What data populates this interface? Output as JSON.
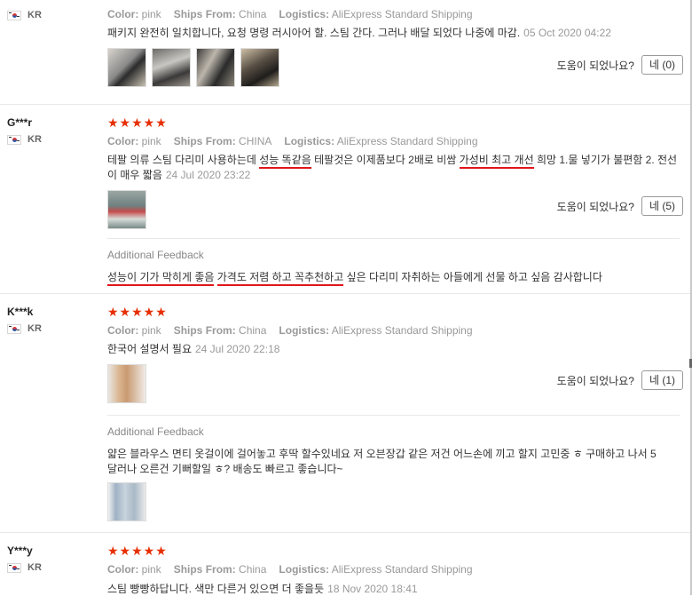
{
  "reviews": [
    {
      "name": "",
      "country": "KR",
      "stars": "",
      "color_label": "Color:",
      "color": "pink",
      "ships_label": "Ships From:",
      "ships": "China",
      "logistics_label": "Logistics:",
      "logistics": "AliExpress Standard Shipping",
      "text": "패키지 완전히 일치합니다, 요청 명령 러시아어 할. 스팀 간다. 그러나 배달 되었다 나중에 마감.",
      "date": "05 Oct 2020 04:22",
      "helpful_question": "도움이 되었나요?",
      "helpful_button": "네 (0)"
    },
    {
      "name": "G***r",
      "country": "KR",
      "stars": "★★★★★",
      "color_label": "Color:",
      "color": "pink",
      "ships_label": "Ships From:",
      "ships": "CHINA",
      "logistics_label": "Logistics:",
      "logistics": "AliExpress Standard Shipping",
      "text_parts": [
        "테팔 의류 스팀 다리미 사용하는데 ",
        "성능 똑같음",
        " 테팔것은 이제품보다 2배로 비쌈 ",
        "가성비 최고 개선",
        " 희망 1.물 넣기가 불편함 2. 전선이 매우 짧음"
      ],
      "date": "24 Jul 2020 23:22",
      "helpful_question": "도움이 되었나요?",
      "helpful_button": "네 (5)",
      "additional_label": "Additional Feedback",
      "additional_parts": [
        "성능이 기가 막히게 좋음",
        " ",
        "가격도 저렴 하고 꼭추천하고",
        " 싶은 다리미 자취하는 아들에게 선물 하고 싶음 감사합니다"
      ]
    },
    {
      "name": "K***k",
      "country": "KR",
      "stars": "★★★★★",
      "color_label": "Color:",
      "color": "pink",
      "ships_label": "Ships From:",
      "ships": "China",
      "logistics_label": "Logistics:",
      "logistics": "AliExpress Standard Shipping",
      "text": "한국어 설명서 필요",
      "date": "24 Jul 2020 22:18",
      "helpful_question": "도움이 되었나요?",
      "helpful_button": "네 (1)",
      "additional_label": "Additional Feedback",
      "additional_text": "얇은 블라우스 면티 옷걸이에 걸어놓고 후딱 할수있네요 저 오븐장갑 같은 저건 어느손에 끼고 할지 고민중 ㅎ 구매하고 나서 5달러나 오른건 기뻐할일 ㅎ? 배송도 빠르고 좋습니다~"
    },
    {
      "name": "Y***y",
      "country": "KR",
      "stars": "★★★★★",
      "color_label": "Color:",
      "color": "pink",
      "ships_label": "Ships From:",
      "ships": "China",
      "logistics_label": "Logistics:",
      "logistics": "AliExpress Standard Shipping",
      "text": "스팀 빵빵하답니다. 색만 다른거 있으면 더 좋을듯",
      "date": "18 Nov 2020 18:41"
    }
  ],
  "colors": {
    "star": "#e62e04",
    "underline": "#e0161b",
    "muted": "#999999"
  }
}
